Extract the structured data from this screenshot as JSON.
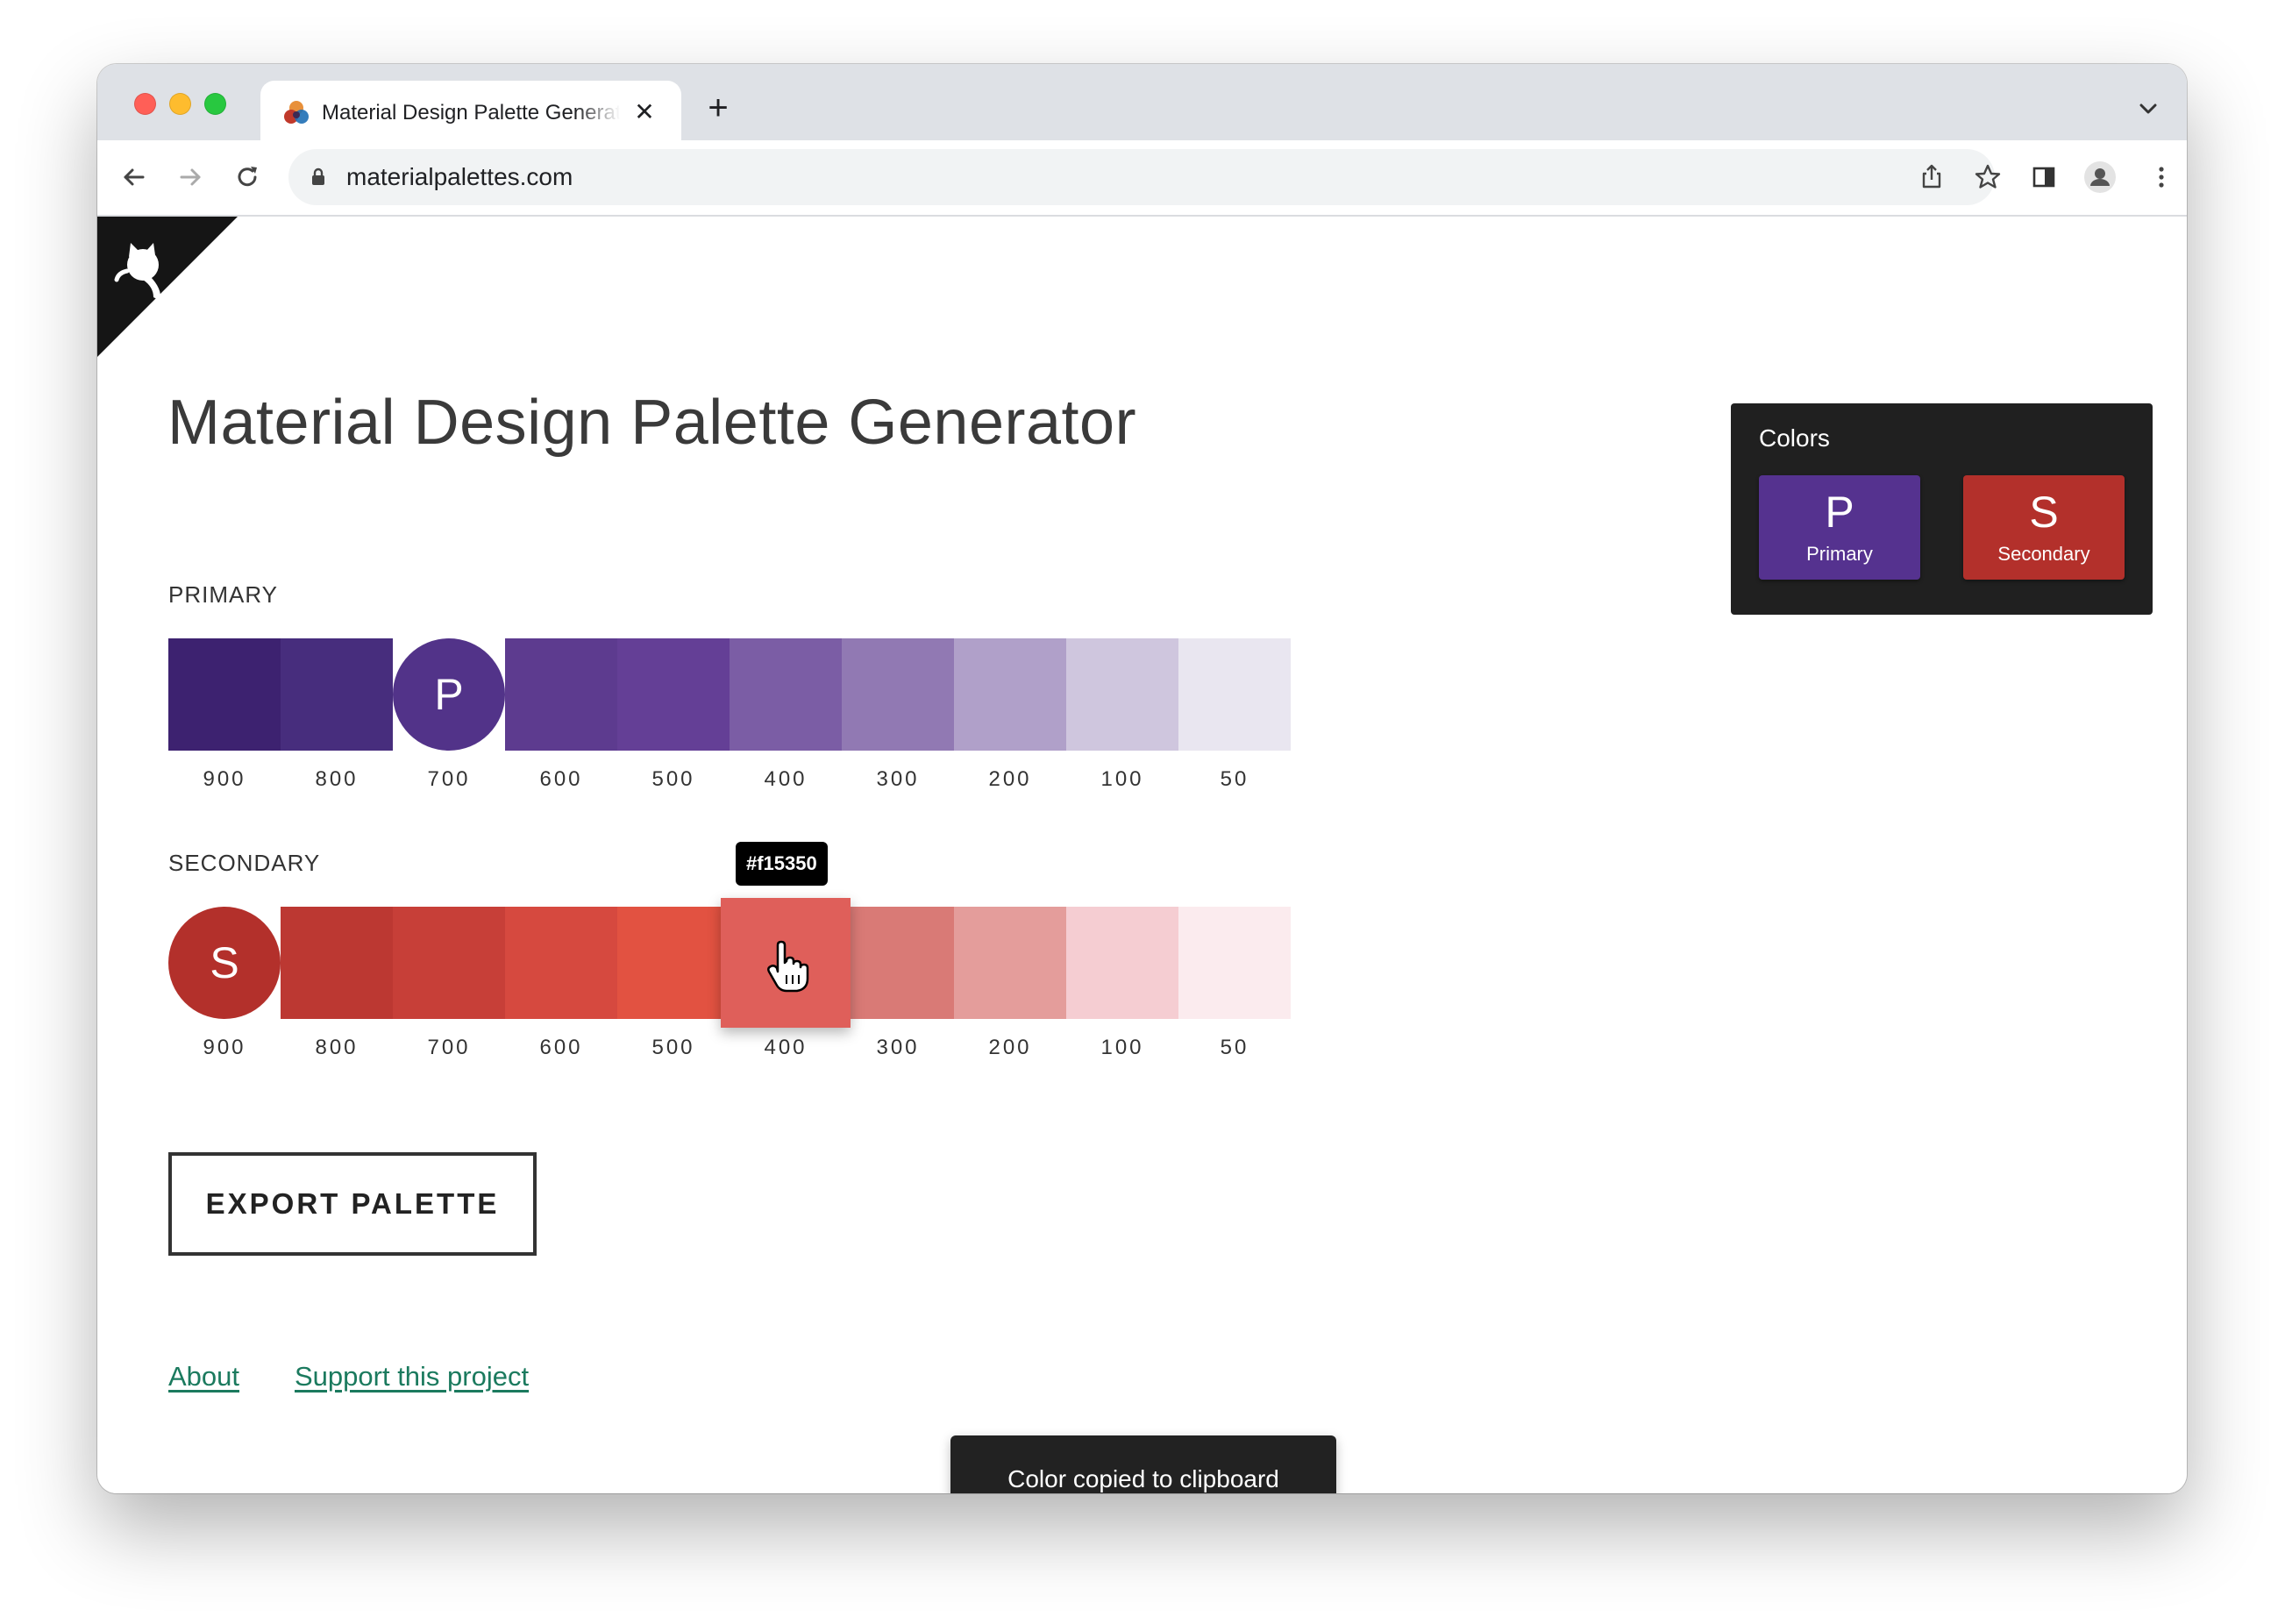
{
  "browser": {
    "tab_title": "Material Design Palette Generator",
    "url": "materialpalettes.com"
  },
  "page": {
    "title": "Material Design Palette Generator",
    "primary_label": "PRIMARY",
    "secondary_label": "SECONDARY",
    "export_label": "EXPORT PALETTE",
    "links": {
      "about": "About",
      "support": "Support this project"
    },
    "snackbar": "Color copied to clipboard",
    "tooltip": "#f15350"
  },
  "colors_panel": {
    "title": "Colors",
    "primary": {
      "letter": "P",
      "label": "Primary",
      "color": "#55328f"
    },
    "secondary": {
      "letter": "S",
      "label": "Secondary",
      "color": "#b3302b"
    }
  },
  "primary_palette": [
    {
      "shade": "900",
      "color": "#3d2270"
    },
    {
      "shade": "800",
      "color": "#472d7d"
    },
    {
      "shade": "700",
      "color": "#523389",
      "letter": "P"
    },
    {
      "shade": "600",
      "color": "#5d3b8f"
    },
    {
      "shade": "500",
      "color": "#643f96"
    },
    {
      "shade": "400",
      "color": "#7b5da5"
    },
    {
      "shade": "300",
      "color": "#9179b3"
    },
    {
      "shade": "200",
      "color": "#b0a0c9"
    },
    {
      "shade": "100",
      "color": "#cfc6de"
    },
    {
      "shade": "50",
      "color": "#e9e6f0"
    }
  ],
  "secondary_palette": [
    {
      "shade": "900",
      "color": "#b3302b",
      "letter": "S"
    },
    {
      "shade": "800",
      "color": "#bc3832"
    },
    {
      "shade": "700",
      "color": "#c73f38"
    },
    {
      "shade": "600",
      "color": "#d6493f"
    },
    {
      "shade": "500",
      "color": "#e25241"
    },
    {
      "shade": "400",
      "color": "#df5f5a"
    },
    {
      "shade": "300",
      "color": "#d97a76"
    },
    {
      "shade": "200",
      "color": "#e49d9b"
    },
    {
      "shade": "100",
      "color": "#f5cdd2"
    },
    {
      "shade": "50",
      "color": "#fbebee"
    }
  ]
}
